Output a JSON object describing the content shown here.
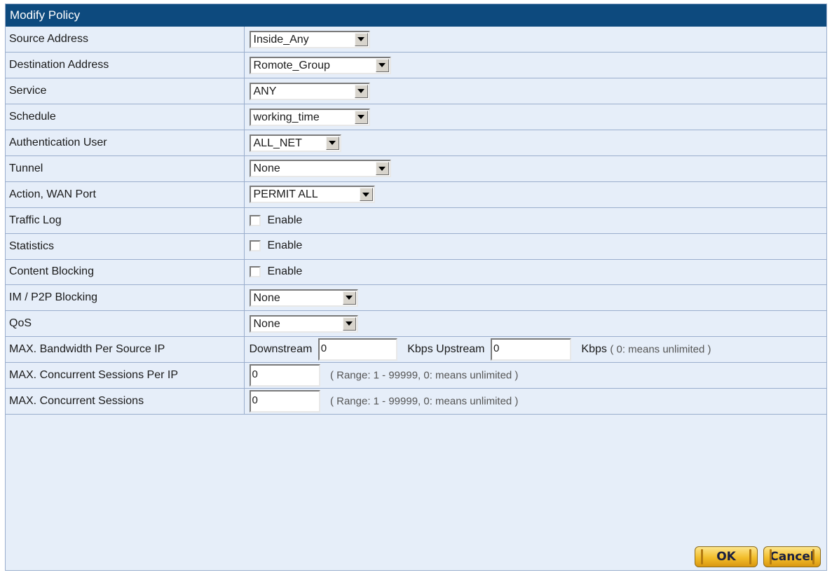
{
  "title": "Modify Policy",
  "rows": [
    {
      "label": "Source Address",
      "value": "Inside_Any"
    },
    {
      "label": "Destination Address",
      "value": "Romote_Group"
    },
    {
      "label": "Service",
      "value": "ANY"
    },
    {
      "label": "Schedule",
      "value": "working_time"
    },
    {
      "label": "Authentication User",
      "value": "ALL_NET"
    },
    {
      "label": "Tunnel",
      "value": "None"
    },
    {
      "label": "Action, WAN Port",
      "value": "PERMIT ALL"
    },
    {
      "label": "Traffic Log",
      "checkbox": "Enable",
      "checked": false
    },
    {
      "label": "Statistics",
      "checkbox": "Enable",
      "checked": false
    },
    {
      "label": "Content Blocking",
      "checkbox": "Enable",
      "checked": false
    },
    {
      "label": "IM / P2P Blocking",
      "value": "None"
    },
    {
      "label": "QoS",
      "value": "None"
    },
    {
      "label": "MAX. Bandwidth Per Source IP",
      "downstream_label": "Downstream",
      "downstream_value": "0",
      "upstream_label": "Kbps Upstream",
      "upstream_value": "0",
      "unit_label": "Kbps",
      "hint": "( 0: means unlimited )"
    },
    {
      "label": "MAX. Concurrent Sessions Per IP",
      "input_value": "0",
      "hint": "( Range: 1 - 99999, 0: means unlimited )"
    },
    {
      "label": "MAX. Concurrent Sessions",
      "input_value": "0",
      "hint": "( Range: 1 - 99999, 0: means unlimited )"
    }
  ],
  "buttons": {
    "ok": "OK",
    "cancel": "Cancel"
  },
  "colors": {
    "title_bar": "#0d4a7e",
    "panel_bg": "#e6eef9",
    "border": "#9aaecd",
    "button": "#f2bd2a"
  },
  "icons": {
    "dropdown": "chevron-down-icon",
    "checkbox": "checkbox-icon"
  }
}
